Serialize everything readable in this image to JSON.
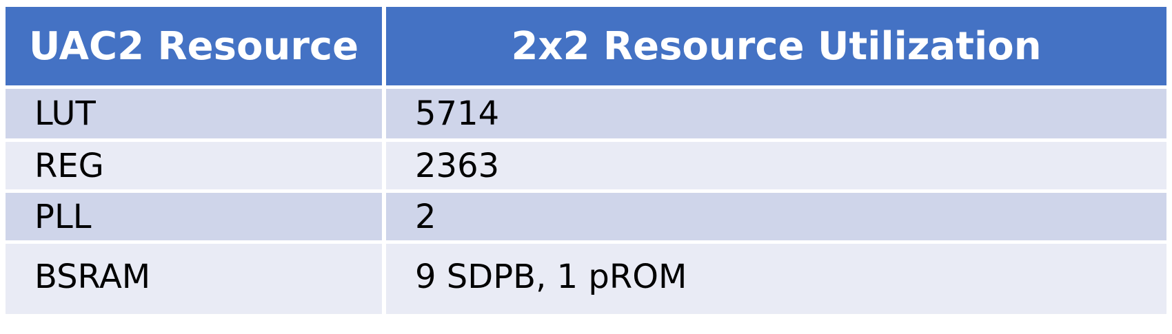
{
  "table": {
    "headers": [
      "UAC2 Resource",
      "2x2 Resource Utilization"
    ],
    "rows": [
      [
        "LUT",
        "5714"
      ],
      [
        "REG",
        "2363"
      ],
      [
        "PLL",
        "2"
      ],
      [
        "BSRAM",
        "9 SDPB, 1 pROM"
      ]
    ]
  },
  "colors": {
    "header": "#4472c4",
    "row_band_dark": "#cfd5ea",
    "row_band_light": "#e9ebf5"
  }
}
